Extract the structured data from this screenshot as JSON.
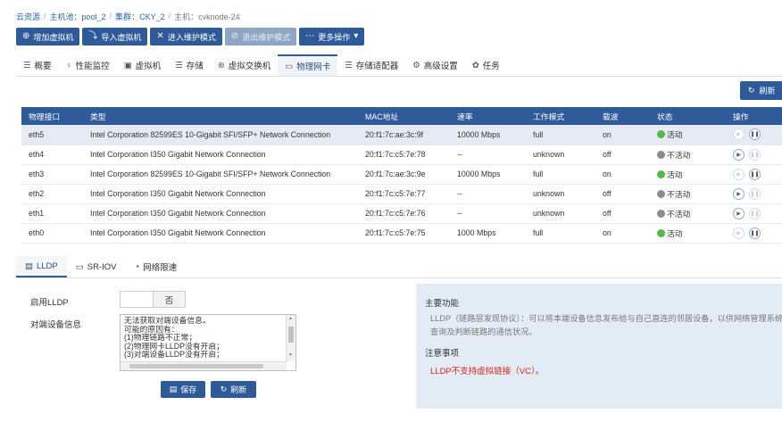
{
  "breadcrumb": [
    {
      "label": "云资源"
    },
    {
      "label": "主机池：pool_2"
    },
    {
      "label": "集群：CKY_2"
    },
    {
      "label": "主机：cvknode-24"
    }
  ],
  "actions": {
    "add_vm": "增加虚拟机",
    "import_vm": "导入虚拟机",
    "enter_maintenance": "进入维护模式",
    "exit_maintenance": "退出维护模式",
    "more_ops": "更多操作"
  },
  "tabs": {
    "overview": "概要",
    "perf": "性能监控",
    "vm": "虚拟机",
    "storage": "存储",
    "vswitch": "虚拟交换机",
    "pnic": "物理网卡",
    "adapter": "存储适配器",
    "advanced": "高级设置",
    "tasks": "任务"
  },
  "refresh_label": "刷新",
  "table": {
    "headers": {
      "port": "物理接口",
      "type": "类型",
      "mac": "MAC地址",
      "speed": "速率",
      "mode": "工作模式",
      "carrier": "载波",
      "status": "状态",
      "ops": "操作"
    },
    "rows": [
      {
        "port": "eth5",
        "type": "Intel Corporation 82599ES 10-Gigabit SFI/SFP+ Network Connection",
        "mac": "20:f1:7c:ae:3c:9f",
        "speed": "10000 Mbps",
        "mode": "full",
        "carrier": "on",
        "status": "活动"
      },
      {
        "port": "eth4",
        "type": "Intel Corporation I350 Gigabit Network Connection",
        "mac": "20:f1:7c:c5:7e:78",
        "speed": "--",
        "mode": "unknown",
        "carrier": "off",
        "status": "不活动"
      },
      {
        "port": "eth3",
        "type": "Intel Corporation 82599ES 10-Gigabit SFI/SFP+ Network Connection",
        "mac": "20:f1:7c:ae:3c:9e",
        "speed": "10000 Mbps",
        "mode": "full",
        "carrier": "on",
        "status": "活动"
      },
      {
        "port": "eth2",
        "type": "Intel Corporation I350 Gigabit Network Connection",
        "mac": "20:f1:7c:c5:7e:77",
        "speed": "--",
        "mode": "unknown",
        "carrier": "off",
        "status": "不活动"
      },
      {
        "port": "eth1",
        "type": "Intel Corporation I350 Gigabit Network Connection",
        "mac": "20:f1:7c:c5:7e:76",
        "speed": "--",
        "mode": "unknown",
        "carrier": "off",
        "status": "不活动"
      },
      {
        "port": "eth0",
        "type": "Intel Corporation I350 Gigabit Network Connection",
        "mac": "20:f1:7c:c5:7e:75",
        "speed": "1000 Mbps",
        "mode": "full",
        "carrier": "on",
        "status": "活动"
      }
    ]
  },
  "subtabs": {
    "lldp": "LLDP",
    "sriov": "SR-IOV",
    "netlimit": "网络限速"
  },
  "lldp": {
    "enable_label": "启用LLDP",
    "toggle_value": "否",
    "peer_label": "对端设备信息",
    "peer_text": "无法获取对端设备信息。\n可能的原因有：\n(1)物理链路不正常；\n(2)物理网卡LLDP没有开启；\n(3)对端设备LLDP没有开启；",
    "save": "保存",
    "refresh": "刷新"
  },
  "info": {
    "main_title": "主要功能",
    "main_text": "LLDP（链路层发现协议）：可以将本端设备信息发布给与自己直连的邻居设备，以供网络管理系统查询及判断链路的通信状况。",
    "note_title": "注意事项",
    "note_text": "LLDP不支持虚拟链接（VC）。"
  }
}
